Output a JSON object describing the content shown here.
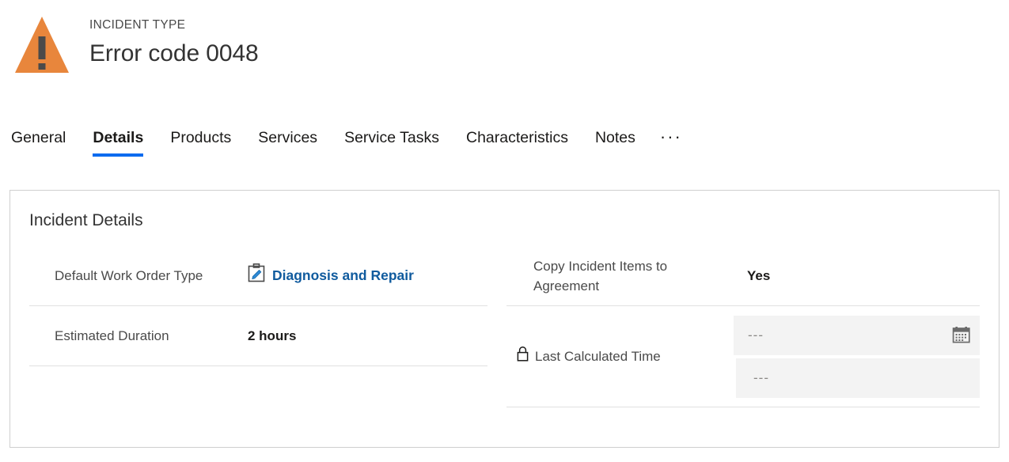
{
  "header": {
    "entity_label": "INCIDENT TYPE",
    "record_title": "Error code 0048",
    "icon": "warning-triangle-icon",
    "icon_color": "#e8863c"
  },
  "tabs": {
    "items": [
      {
        "label": "General",
        "active": false
      },
      {
        "label": "Details",
        "active": true
      },
      {
        "label": "Products",
        "active": false
      },
      {
        "label": "Services",
        "active": false
      },
      {
        "label": "Service Tasks",
        "active": false
      },
      {
        "label": "Characteristics",
        "active": false
      },
      {
        "label": "Notes",
        "active": false
      }
    ],
    "overflow_label": "···",
    "active_underline_color": "#0b6bef"
  },
  "card": {
    "section_title": "Incident Details",
    "left_column": [
      {
        "label": "Default Work Order Type",
        "value": "Diagnosis and Repair",
        "value_type": "link",
        "icon": "clipboard-pencil-icon",
        "link_color": "#105b9e"
      },
      {
        "label": "Estimated Duration",
        "value": "2 hours",
        "value_type": "text"
      }
    ],
    "right_column": [
      {
        "label": "Copy Incident Items to Agreement",
        "value": "Yes",
        "value_type": "text"
      },
      {
        "label": "Last Calculated Time",
        "value_type": "datetime-readonly",
        "icon": "lock-icon",
        "date_placeholder": "---",
        "time_placeholder": "---",
        "calendar_icon": "calendar-icon",
        "field_background": "#f3f3f3"
      }
    ]
  }
}
